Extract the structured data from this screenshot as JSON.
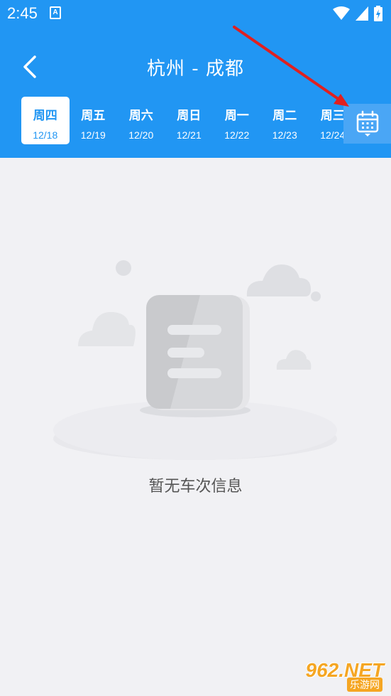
{
  "status_bar": {
    "time": "2:45",
    "app_icon_letter": "A",
    "icons": [
      "wifi-icon",
      "signal-icon",
      "battery-icon"
    ]
  },
  "header": {
    "back_icon": "chevron-left-icon",
    "title": "杭州 - 成都"
  },
  "date_tabs": [
    {
      "weekday": "周四",
      "date": "12/18",
      "selected": true
    },
    {
      "weekday": "周五",
      "date": "12/19",
      "selected": false
    },
    {
      "weekday": "周六",
      "date": "12/20",
      "selected": false
    },
    {
      "weekday": "周日",
      "date": "12/21",
      "selected": false
    },
    {
      "weekday": "周一",
      "date": "12/22",
      "selected": false
    },
    {
      "weekday": "周二",
      "date": "12/23",
      "selected": false
    },
    {
      "weekday": "周三",
      "date": "12/24",
      "selected": false
    }
  ],
  "calendar_button": {
    "icon": "calendar-icon"
  },
  "empty_state": {
    "illustration": "empty-document-illustration",
    "message": "暂无车次信息"
  },
  "watermark": {
    "logo": "962.NET",
    "site": "乐游网"
  },
  "colors": {
    "primary": "#2196f3",
    "background": "#f1f1f4",
    "annotation_arrow": "#e02020",
    "watermark": "#f5a623"
  }
}
